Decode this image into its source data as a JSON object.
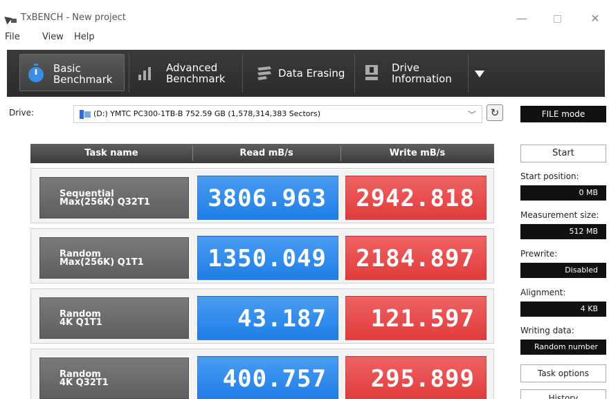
{
  "window": {
    "title": "TxBENCH - New project",
    "min": "—",
    "close": "✕"
  },
  "menu": [
    "File",
    "View",
    "Help"
  ],
  "toolbar": {
    "tabs": [
      {
        "line1": "Basic",
        "line2": "Benchmark",
        "icon": "stopwatch-icon",
        "active": true
      },
      {
        "line1": "Advanced",
        "line2": "Benchmark",
        "icon": "bar-chart-icon",
        "active": false
      },
      {
        "line1": "Data Erasing",
        "line2": "",
        "icon": "erase-icon",
        "active": false
      },
      {
        "line1": "Drive",
        "line2": "Information",
        "icon": "drive-info-icon",
        "active": false
      }
    ]
  },
  "drive": {
    "label": "Drive:",
    "selected": "(D:) YMTC PC300-1TB-B  752.59 GB (1,578,314,383 Sectors)",
    "mode": "FILE mode"
  },
  "table": {
    "headers": [
      "Task name",
      "Read mB/s",
      "Write mB/s"
    ],
    "rows": [
      {
        "task_line1": "Sequential",
        "task_line2": "Max(256K) Q32T1",
        "read": "3806.963",
        "write": "2942.818"
      },
      {
        "task_line1": "Random",
        "task_line2": "Max(256K) Q1T1",
        "read": "1350.049",
        "write": "2184.897"
      },
      {
        "task_line1": "Random",
        "task_line2": "4K Q1T1",
        "read": "43.187",
        "write": "121.597"
      },
      {
        "task_line1": "Random",
        "task_line2": "4K Q32T1",
        "read": "400.757",
        "write": "295.899"
      }
    ]
  },
  "panel": {
    "start": "Start",
    "start_position_label": "Start position:",
    "start_position": "0 MB",
    "measurement_size_label": "Measurement size:",
    "measurement_size": "512 MB",
    "prewrite_label": "Prewrite:",
    "prewrite": "Disabled",
    "alignment_label": "Alignment:",
    "alignment": "4 KB",
    "writing_data_label": "Writing data:",
    "writing_data": "Random number",
    "task_options": "Task options",
    "history": "History"
  },
  "colors": {
    "read": "#1e7ee6",
    "write": "#e03c3c",
    "toolbar": "#2b2b2b"
  }
}
